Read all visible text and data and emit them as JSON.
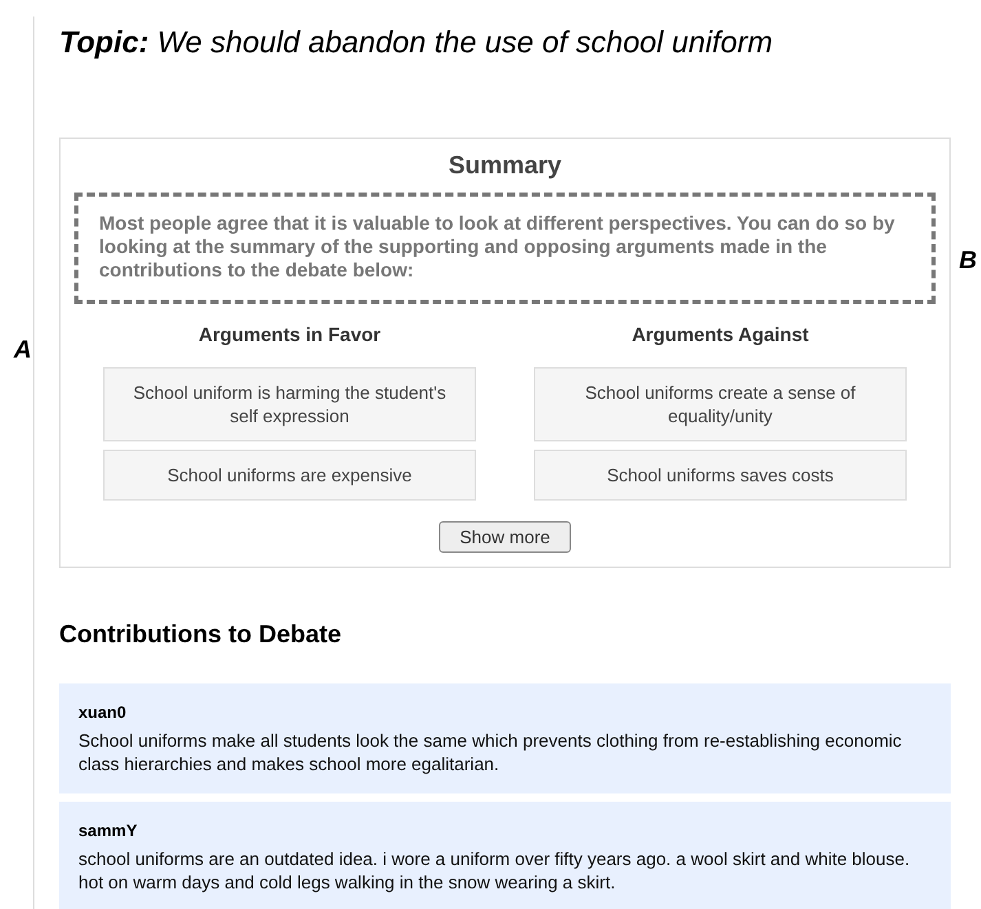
{
  "topic": {
    "label": "Topic:",
    "text": "We should abandon the use of school uniform"
  },
  "side_labels": [
    "A",
    "B"
  ],
  "summary": {
    "title": "Summary",
    "intro": "Most people agree that it is valuable to look at different perspectives. You can do so by looking at the summary of the supporting and opposing arguments made in the contributions to the debate below:",
    "columns": [
      {
        "heading": "Arguments in Favor",
        "arguments": [
          "School uniform is harming the student's self expression",
          "School uniforms are expensive"
        ]
      },
      {
        "heading": "Arguments Against",
        "arguments": [
          "School uniforms create a sense of equality/unity",
          "School uniforms saves costs"
        ]
      }
    ],
    "show_more": "Show more"
  },
  "contributions": {
    "title": "Contributions to Debate",
    "items": [
      {
        "author": "xuan0",
        "text": "School uniforms make all students look the same which prevents clothing from re-establishing economic class hierarchies and makes school more egalitarian."
      },
      {
        "author": "sammY",
        "text": "school uniforms are an outdated idea. i wore a uniform over fifty years ago. a wool skirt and white blouse. hot on warm days and cold legs walking in the snow wearing a skirt."
      }
    ]
  }
}
